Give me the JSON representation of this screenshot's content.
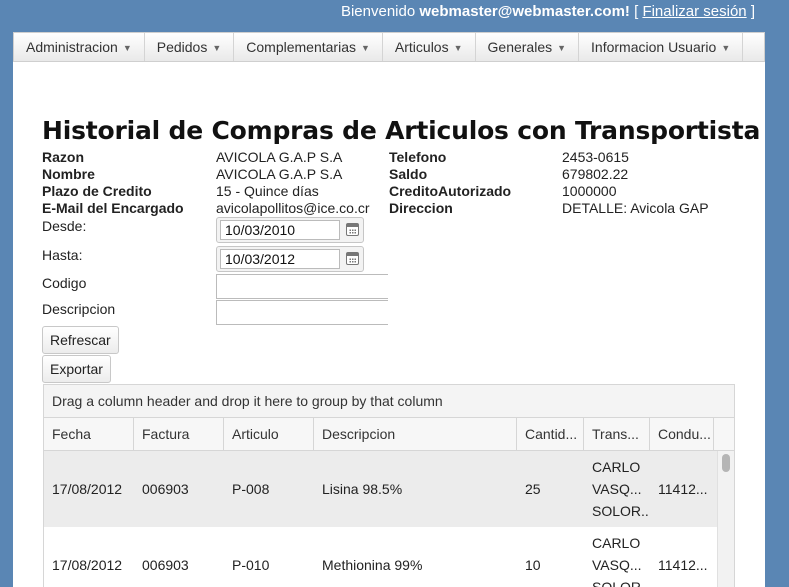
{
  "topbar": {
    "welcome": "Bienvenido",
    "user": "webmaster@webmaster.com!",
    "bracket_open": "[",
    "logout": "Finalizar sesión",
    "bracket_close": "]"
  },
  "nav": [
    "Administracion",
    "Pedidos",
    "Complementarias",
    "Articulos",
    "Generales",
    "Informacion Usuario"
  ],
  "page_title": "Historial de Compras de Articulos con Transportista",
  "info": {
    "razon_label": "Razon",
    "razon_value": "AVICOLA G.A.P S.A",
    "nombre_label": "Nombre",
    "nombre_value": "AVICOLA G.A.P S.A",
    "plazo_label": "Plazo de Credito",
    "plazo_value": "15 - Quince días",
    "email_label": "E-Mail del Encargado",
    "email_value": "avicolapollitos@ice.co.cr",
    "telefono_label": "Telefono",
    "telefono_value": "2453-0615",
    "saldo_label": "Saldo",
    "saldo_value": "679802.22",
    "credito_label": "CreditoAutorizado",
    "credito_value": "1000000",
    "direccion_label": "Direccion",
    "direccion_value": "DETALLE: Avicola GAP"
  },
  "form": {
    "desde_label": "Desde:",
    "desde_value": "10/03/2010",
    "hasta_label": "Hasta:",
    "hasta_value": "10/03/2012",
    "codigo_label": "Codigo",
    "codigo_value": "",
    "descripcion_label": "Descripcion",
    "descripcion_value": ""
  },
  "buttons": {
    "refrescar": "Refrescar",
    "exportar": "Exportar"
  },
  "grid": {
    "group_hint": "Drag a column header and drop it here to group by that column",
    "columns": [
      "Fecha",
      "Factura",
      "Articulo",
      "Descripcion",
      "Cantid...",
      "Trans...",
      "Condu..."
    ],
    "rows": [
      {
        "fecha": "17/08/2012",
        "factura": "006903",
        "articulo": "P-008",
        "descripcion": "Lisina 98.5%",
        "cantidad": "25",
        "trans": [
          "CARLO",
          "VASQ...",
          "SOLOR..."
        ],
        "conductor": "11412..."
      },
      {
        "fecha": "17/08/2012",
        "factura": "006903",
        "articulo": "P-010",
        "descripcion": "Methionina 99%",
        "cantidad": "10",
        "trans": [
          "CARLO",
          "VASQ...",
          "SOLOR..."
        ],
        "conductor": "11412..."
      }
    ]
  }
}
